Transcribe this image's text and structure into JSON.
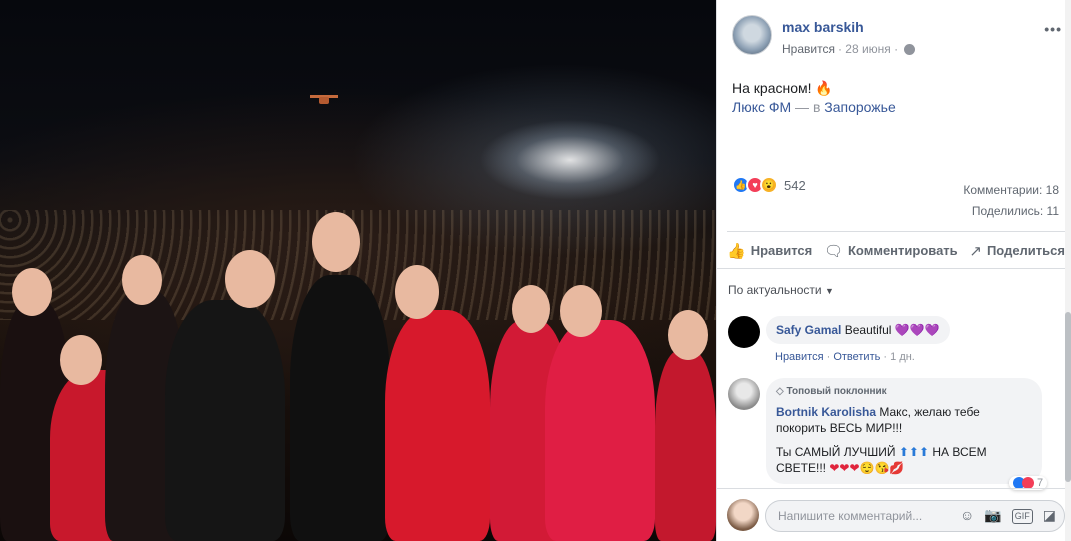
{
  "post": {
    "author": "max barskih",
    "liked_label": "Нравится",
    "date": "· 28 июня ·",
    "text": "На красном!",
    "location_prefix": "Люкс ФМ",
    "location_sep": " — в ",
    "location_city": "Запорожье",
    "reactions_count": "542",
    "comments_label": "Комментарии: 18",
    "shares_label": "Поделились: 11"
  },
  "actions": {
    "like": "Нравится",
    "comment": "Комментировать",
    "share": "Поделиться"
  },
  "sort": {
    "label": "По актуальности"
  },
  "comments": [
    {
      "name": "Safy Gamal",
      "text": "Beautiful",
      "emoji": "💜💜💜",
      "like": "Нравится",
      "reply": "Ответить",
      "time": "1 дн."
    },
    {
      "badge": "Топовый поклонник",
      "name": "Bortnik Karolisha",
      "text": "Макс, желаю тебе покорить ВЕСЬ МИР!!!",
      "text2": "Ты САМЫЙ ЛУЧШИЙ",
      "text2_emoji": "⬆⬆⬆",
      "text2_end": "НА ВСЕМ СВЕТЕ!!!",
      "text2_emoji_end": "❤❤❤😌😘💋",
      "react_count": "7"
    }
  ],
  "composer": {
    "placeholder": "Напишите комментарий..."
  },
  "icons": {
    "more": "more-icon",
    "globe": "globe-icon",
    "like": "thumbs-up-icon",
    "comment": "comment-icon",
    "share": "share-icon",
    "emoji": "emoji-icon",
    "camera": "camera-icon",
    "gif": "gif-icon",
    "sticker": "sticker-icon"
  },
  "colors": {
    "link": "#385898",
    "like": "#2078f4",
    "love": "#f33e58",
    "wow": "#f7b125"
  }
}
